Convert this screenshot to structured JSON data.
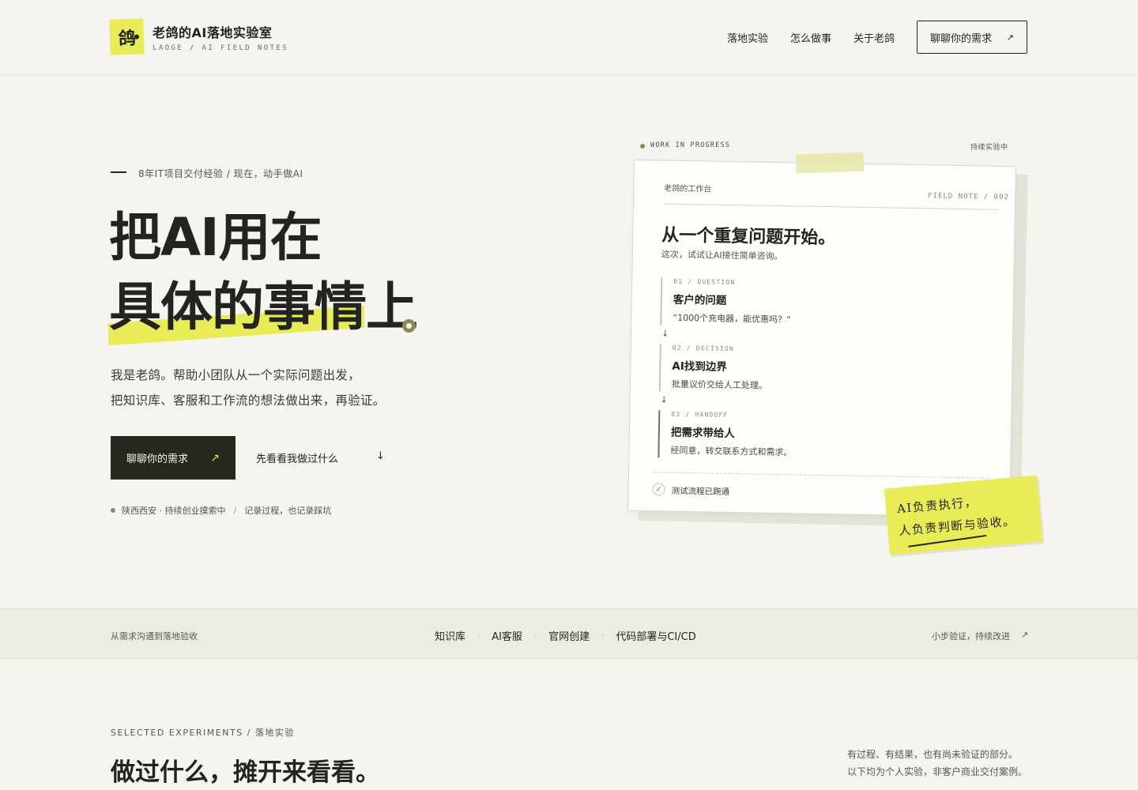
{
  "header": {
    "logo_char": "鸽",
    "brand_title": "老鸽的AI落地实验室",
    "brand_sub": "LAOGE / AI FIELD NOTES",
    "nav": [
      "落地实验",
      "怎么做事",
      "关于老鸽"
    ],
    "cta_label": "聊聊你的需求",
    "cta_arrow": "↗"
  },
  "hero": {
    "eyebrow": "8年IT项目交付经验 / 现在，动手做AI",
    "title_line1": "把AI用在",
    "title_line2": "具体的事情上",
    "desc_line1": "我是老鸽。帮助小团队从一个实际问题出发，",
    "desc_line2": "把知识库、客服和工作流的想法做出来，再验证。",
    "primary_btn": "聊聊你的需求",
    "primary_arrow": "↗",
    "ghost_btn": "先看看我做过什么",
    "ghost_arrow": "↓",
    "meta_location": "陕西西安 · 持续创业摸索中",
    "meta_sep": "/",
    "meta_note": "记录过程，也记录踩坑"
  },
  "note_card": {
    "wip_label": "WORK IN PROGRESS",
    "wip_right": "持续实验中",
    "workbench": "老鸽的工作台",
    "field_note": "FIELD NOTE / 002",
    "title": "从一个重复问题开始。",
    "subtitle": "这次，试试让AI接住简单咨询。",
    "steps": [
      {
        "label": "01 / QUESTION",
        "title": "客户的问题",
        "text": "“1000个充电器，能优惠吗？”"
      },
      {
        "label": "02 / DECISION",
        "title": "AI找到边界",
        "text": "批量议价交给人工处理。"
      },
      {
        "label": "03 / HANDOFF",
        "title": "把需求带给人",
        "text": "经同意，转交联系方式和需求。"
      }
    ],
    "arrow": "↓",
    "status_check": "✓",
    "status": "测试流程已跑通",
    "sticky_line1": "AI负责执行，",
    "sticky_line2": "人负责判断与验收。"
  },
  "band": {
    "left": "从需求沟通到落地验收",
    "items": [
      "知识库",
      "AI客服",
      "官网创建",
      "代码部署与CI/CD"
    ],
    "dot": "·",
    "right": "小步验证，持续改进",
    "right_arrow": "↗"
  },
  "section": {
    "eyebrow": "SELECTED EXPERIMENTS / 落地实验",
    "title": "做过什么，摊开来看看。",
    "note_line1": "有过程、有结果，也有尚未验证的部分。",
    "note_line2": "以下均为个人实验，非客户商业交付案例。"
  },
  "colors": {
    "background": "#f5f4ef",
    "ink": "#23241f",
    "accent": "#e8ec56",
    "olive": "#8a8a55"
  }
}
